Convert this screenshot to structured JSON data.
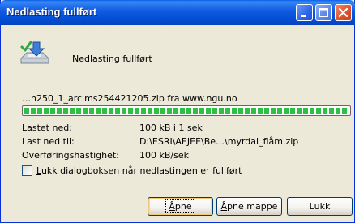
{
  "window": {
    "title": "Nedlasting fullført",
    "buttons": {
      "minimize_icon": "minimize-icon",
      "maximize_icon": "maximize-icon",
      "close_icon": "close-icon"
    },
    "colors": {
      "titlebar": "#0550d8",
      "client_background": "#ece9d8",
      "progress_fill": "#2fbf45",
      "close_button": "#e0532d"
    }
  },
  "heading": {
    "icon": "download-complete-icon",
    "text": "Nedlasting fullført"
  },
  "download": {
    "source": "…n250_1_arcims254421205.zip fra www.ngu.no",
    "progress": 1.0,
    "rows": [
      {
        "label": "Lastet ned:",
        "value": "100 kB i 1 sek"
      },
      {
        "label": "Last ned til:",
        "value": "D:\\ESRI\\AEJEE\\Be…\\myrdal_flåm.zip"
      },
      {
        "label": "Overføringshastighet:",
        "value": "100 kB/sek"
      }
    ]
  },
  "options": {
    "close_on_complete": {
      "checked": false,
      "label_accel": "L",
      "label_rest": "ukk dialogboksen når nedlastingen er fullført"
    }
  },
  "buttons": {
    "open": {
      "accel": "Å",
      "rest": "pne"
    },
    "open_folder": {
      "accel": "Å",
      "rest": "pne mappe"
    },
    "close": {
      "label": "Lukk"
    }
  }
}
